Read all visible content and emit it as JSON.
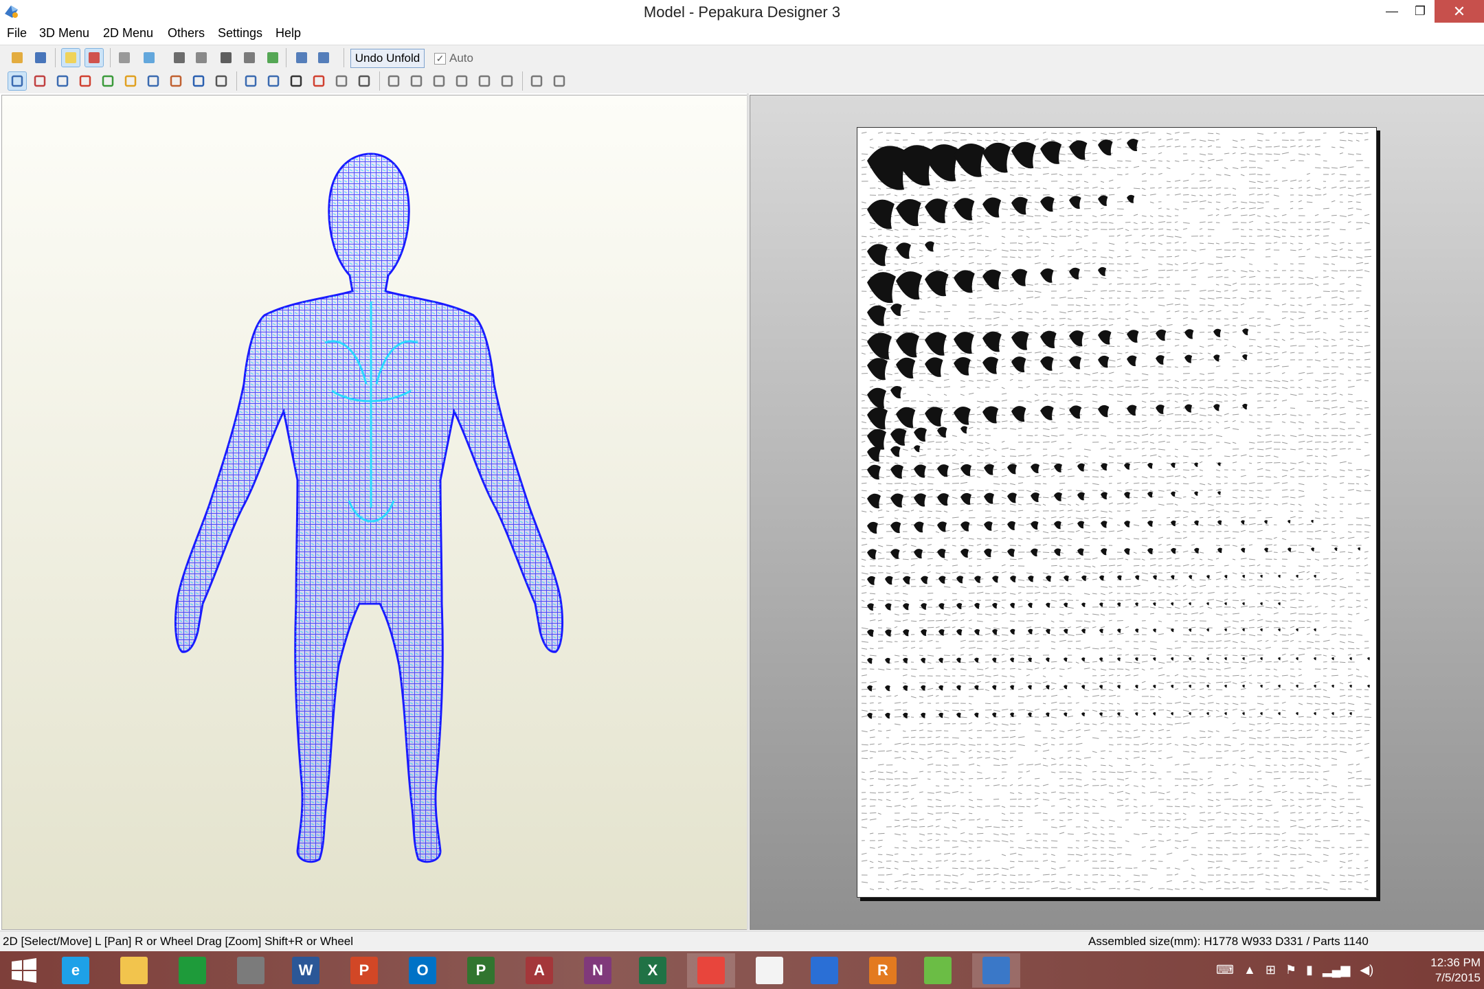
{
  "window": {
    "title": "Model - Pepakura Designer 3",
    "minimize_glyph": "—",
    "maximize_glyph": "❐",
    "close_glyph": "✕"
  },
  "menu": [
    "File",
    "3D Menu",
    "2D Menu",
    "Others",
    "Settings",
    "Help"
  ],
  "toolbar": {
    "undo_unfold_label": "Undo Unfold",
    "auto_label": "Auto",
    "auto_checked": true,
    "row1_icons": [
      "open-folder-icon",
      "save-icon",
      "light-bulb-icon",
      "color-cube-icon",
      "wireframe-cube-icon",
      "flat-cube-icon",
      "edit-pencil-icon",
      "unfold-icon",
      "anchor-icon",
      "split-icon",
      "add-part-icon",
      "single-view-icon",
      "dual-view-icon"
    ],
    "row2_icons": [
      "select-arrow-icon",
      "edge-tool-icon",
      "flaps-icon",
      "paint-icon",
      "join-icon",
      "text-tool-icon",
      "image-tool-icon",
      "rotate-part-icon",
      "undo-icon",
      "redo-icon",
      "fit-icon",
      "arrange-icon",
      "page-number-icon",
      "layout-icon",
      "print-preview-icon",
      "print-icon",
      "align-left-icon",
      "align-center-icon",
      "align-right-icon",
      "align-top-icon",
      "align-middle-icon",
      "align-bottom-icon",
      "rotate-90-ccw-icon",
      "rotate-90-cw-icon"
    ]
  },
  "status": {
    "left": "2D [Select/Move] L [Pan] R or Wheel Drag [Zoom] Shift+R or Wheel",
    "right": "Assembled size(mm): H1778 W933 D331 / Parts 1140"
  },
  "taskbar": {
    "apps": [
      {
        "name": "start-button",
        "glyph": "",
        "color": "#ffffff"
      },
      {
        "name": "internet-explorer-icon",
        "glyph": "e",
        "color": "#1ea1e8"
      },
      {
        "name": "file-explorer-icon",
        "glyph": "",
        "color": "#f2c44d"
      },
      {
        "name": "store-icon",
        "glyph": "",
        "color": "#1e9b3a"
      },
      {
        "name": "calculator-icon",
        "glyph": "",
        "color": "#7b7b7b"
      },
      {
        "name": "word-icon",
        "glyph": "W",
        "color": "#2b5797"
      },
      {
        "name": "powerpoint-icon",
        "glyph": "P",
        "color": "#d24726"
      },
      {
        "name": "outlook-icon",
        "glyph": "O",
        "color": "#0072c6"
      },
      {
        "name": "project-icon",
        "glyph": "P",
        "color": "#31752f"
      },
      {
        "name": "access-icon",
        "glyph": "A",
        "color": "#a4373a"
      },
      {
        "name": "onenote-icon",
        "glyph": "N",
        "color": "#80397b"
      },
      {
        "name": "excel-icon",
        "glyph": "X",
        "color": "#207245"
      },
      {
        "name": "chrome-icon",
        "glyph": "",
        "color": "#e8453c"
      },
      {
        "name": "apps-grid-icon",
        "glyph": "",
        "color": "#f3f3f3"
      },
      {
        "name": "network-tool-icon",
        "glyph": "",
        "color": "#2a6fd6"
      },
      {
        "name": "revit-icon",
        "glyph": "R",
        "color": "#e37a1f"
      },
      {
        "name": "sketch-app-icon",
        "glyph": "",
        "color": "#6bbd45"
      },
      {
        "name": "pepakura-icon",
        "glyph": "",
        "color": "#3a78c8"
      }
    ],
    "time": "12:36 PM",
    "date": "7/5/2015"
  }
}
